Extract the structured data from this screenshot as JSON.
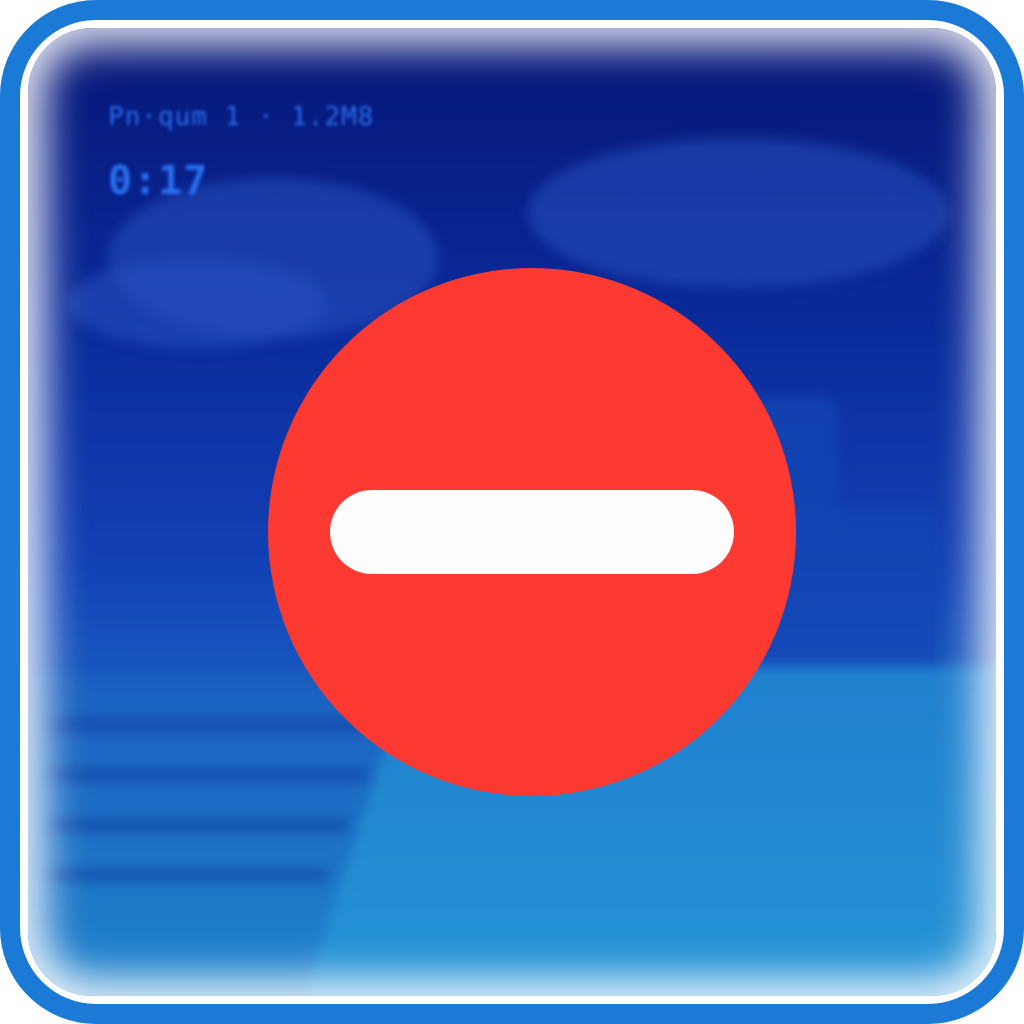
{
  "icon": {
    "name": "blocked-icon",
    "symbol": "no-entry",
    "colors": {
      "border": "#1b7ad6",
      "sign": "#fd3a32",
      "bar": "#fdfdfd",
      "background_top": "#061677",
      "background_bottom": "#1f86cf"
    }
  },
  "game_preview": {
    "hud_line_1": "Pn·qum 1 · 1.2M8",
    "hud_line_2": "0:17"
  }
}
